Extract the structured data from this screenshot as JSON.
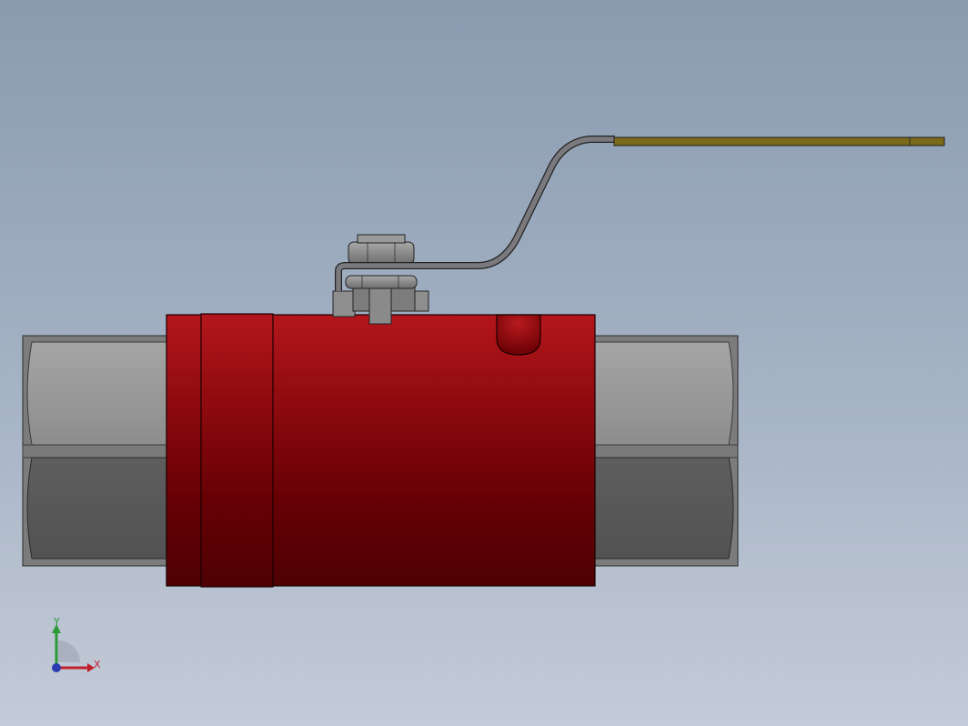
{
  "viewport": {
    "background_top": "#8a9bb0",
    "background_bottom": "#c4cbd8"
  },
  "model": {
    "body_color": "#a01418",
    "body_shadow": "#4e0003",
    "end_fitting_light": "#939393",
    "end_fitting_dark": "#585858",
    "handle_color": "#6b6a6e",
    "handle_grip_color": "#7a6a1a",
    "nut_color": "#8e8e8e"
  },
  "triad": {
    "x_label": "X",
    "y_label": "Y",
    "x_color": "#c0202a",
    "y_color": "#2a9a36",
    "z_color": "#2a3ab0"
  }
}
